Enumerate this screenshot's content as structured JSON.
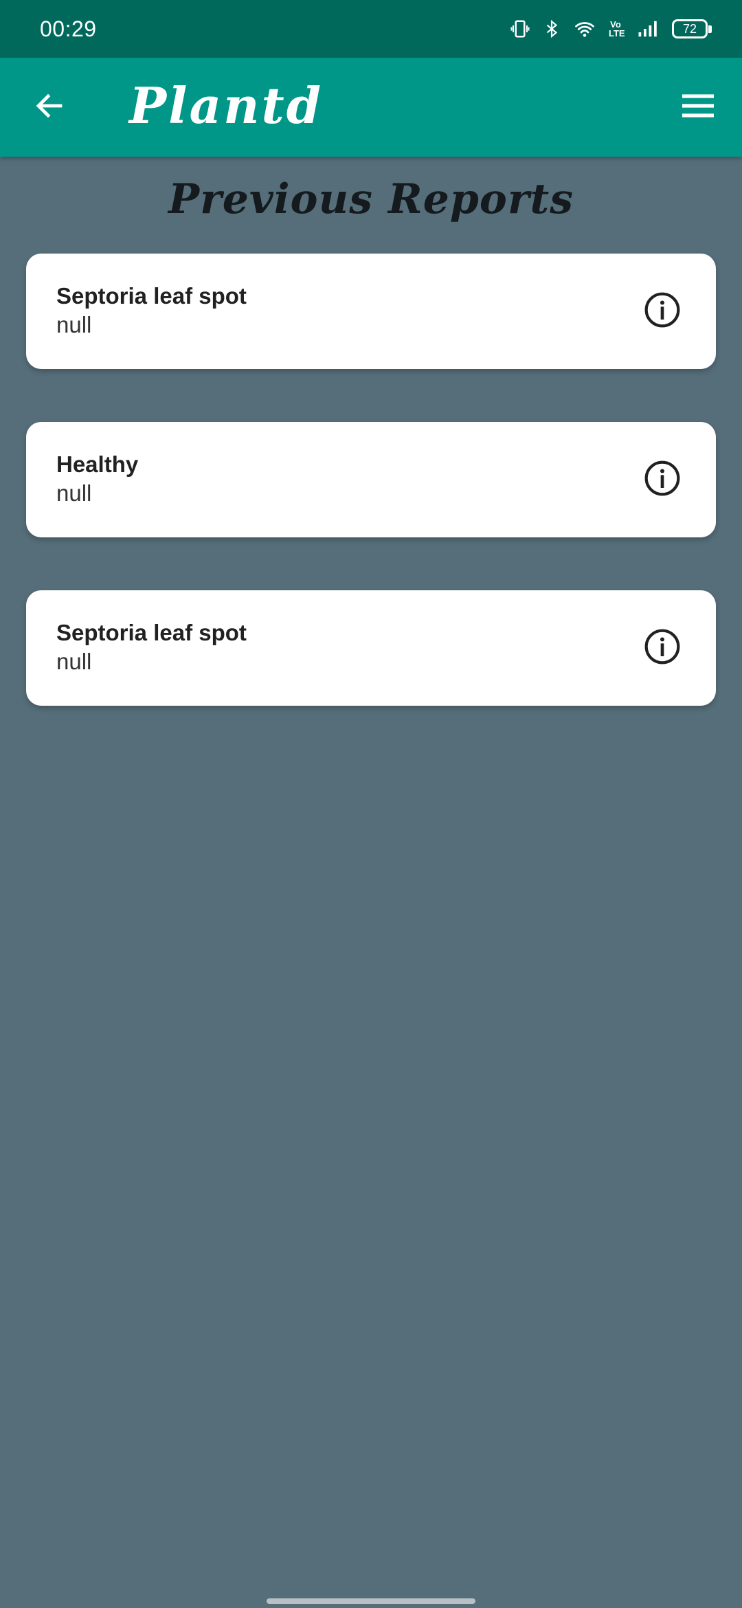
{
  "status_bar": {
    "time": "00:29",
    "volte_top": "Vo",
    "volte_bottom": "LTE",
    "battery": "72",
    "icons": [
      "vibrate-icon",
      "bluetooth-icon",
      "wifi-icon",
      "volte-icon",
      "signal-icon",
      "battery-icon"
    ]
  },
  "app_bar": {
    "title": "Plantd",
    "back_icon": "arrow-left-icon",
    "menu_icon": "hamburger-menu-icon",
    "color": "#009688"
  },
  "page": {
    "title": "Previous Reports",
    "background": "#566e7a"
  },
  "reports": [
    {
      "title": "Septoria leaf spot",
      "subtitle": "null",
      "icon": "info-icon"
    },
    {
      "title": "Healthy",
      "subtitle": "null",
      "icon": "info-icon"
    },
    {
      "title": "Septoria leaf spot",
      "subtitle": "null",
      "icon": "info-icon"
    }
  ]
}
